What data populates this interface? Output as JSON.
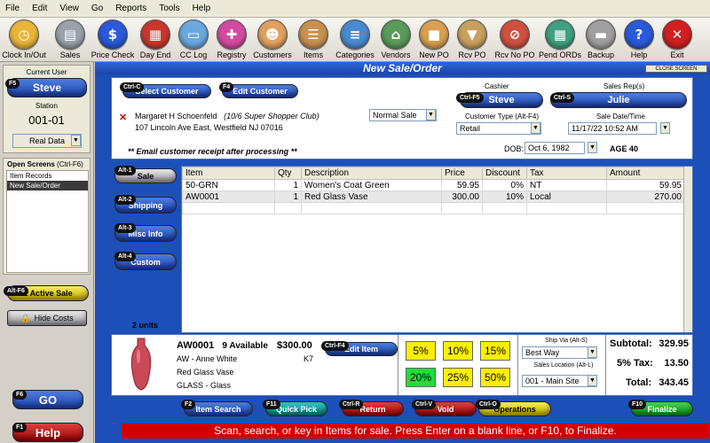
{
  "menu": [
    "File",
    "Edit",
    "View",
    "Go",
    "Reports",
    "Tools",
    "Help"
  ],
  "toolbar": [
    {
      "label": "Clock In/Out",
      "icon": "clock-icon",
      "color": "#e9b53a"
    },
    {
      "label": "Sales",
      "icon": "cash-drawer-icon",
      "color": "#9aa2aa"
    },
    {
      "label": "Price Check",
      "icon": "dollar-icon",
      "color": "#2b59d9"
    },
    {
      "label": "Day End",
      "icon": "calendar-icon",
      "color": "#c8382c"
    },
    {
      "label": "CC Log",
      "icon": "credit-card-icon",
      "color": "#6aa8e0"
    },
    {
      "label": "Registry",
      "icon": "gift-icon",
      "color": "#d24aa0"
    },
    {
      "label": "Customers",
      "icon": "customers-icon",
      "color": "#e0a060"
    },
    {
      "label": "Items",
      "icon": "shelves-icon",
      "color": "#c89050"
    },
    {
      "label": "Categories",
      "icon": "categories-icon",
      "color": "#4a8ad0"
    },
    {
      "label": "Vendors",
      "icon": "vendors-icon",
      "color": "#5a9a5a"
    },
    {
      "label": "New PO",
      "icon": "box-icon",
      "color": "#d8a050"
    },
    {
      "label": "Rcv PO",
      "icon": "receive-box-icon",
      "color": "#c8a060"
    },
    {
      "label": "Rcv No PO",
      "icon": "no-po-icon",
      "color": "#d05040"
    },
    {
      "label": "Pend ORDs",
      "icon": "pending-orders-icon",
      "color": "#40a080"
    },
    {
      "label": "Backup",
      "icon": "backup-icon",
      "color": "#a0a0a0"
    },
    {
      "label": "Help",
      "icon": "help-icon",
      "color": "#2b59d9"
    },
    {
      "label": "Exit",
      "icon": "exit-icon",
      "color": "#d02020"
    }
  ],
  "left": {
    "current_user_label": "Current User",
    "user_key": "F5",
    "user": "Steve",
    "station_label": "Station",
    "station": "001-01",
    "data_mode": "Real Data",
    "open_screens_title": "Open Screens",
    "open_screens_hint": "(Ctrl-F6)",
    "open_screens": [
      "Item Records",
      "New Sale/Order"
    ],
    "active_sale_key": "Alt-F6",
    "active_sale": "1 Active Sale",
    "hide_costs": "Hide Costs",
    "go_key": "F6",
    "go": "GO",
    "help_key": "F1",
    "help": "Help"
  },
  "window": {
    "title": "New Sale/Order",
    "close": "CLOSE SCREEN"
  },
  "customer": {
    "select_key": "Ctrl-C",
    "select": "Select Customer",
    "edit_key": "F4",
    "edit": "Edit Customer",
    "name": "Margaret H Schoenfeld",
    "club": "(10/6 Super Shopper Club)",
    "address": "107 Lincoln Ave East, Westfield NJ  07016",
    "email_note": "** Email customer receipt after processing **",
    "sale_type": "Normal Sale",
    "cashier_label": "Cashier",
    "cashier_key": "Ctrl-F5",
    "cashier": "Steve",
    "rep_label": "Sales Rep(s)",
    "rep_key": "Ctrl-S",
    "rep": "Julie",
    "ctype_label": "Customer Type (Alt-F4)",
    "ctype": "Retail",
    "date_label": "Sale Date/Time",
    "date": "11/17/22 10:52 AM",
    "dob_label": "DOB:",
    "dob": "Oct 6, 1982",
    "age": "AGE 40"
  },
  "side_tabs": [
    {
      "key": "Alt-1",
      "label": "Sale"
    },
    {
      "key": "Alt-2",
      "label": "Shipping"
    },
    {
      "key": "Alt-3",
      "label": "Misc Info"
    },
    {
      "key": "Alt-4",
      "label": "Custom"
    }
  ],
  "units": "2 units",
  "grid": {
    "headers": [
      "Item",
      "Qty",
      "Description",
      "Price",
      "Discount",
      "Tax",
      "Amount"
    ],
    "rows": [
      [
        "50-GRN",
        "1",
        "Women's Coat Green",
        "59.95",
        "0%",
        "NT",
        "59.95"
      ],
      [
        "AW0001",
        "1",
        "Red Glass Vase",
        "300.00",
        "10%",
        "Local",
        "270.00"
      ]
    ]
  },
  "detail": {
    "code": "AW0001",
    "available": "9 Available",
    "price": "$300.00",
    "vendor": "AW - Anne White",
    "bin": "K7",
    "desc": "Red Glass Vase",
    "cat": "GLASS - Glass",
    "edit_key": "Ctrl-F4",
    "edit": "Edit Item"
  },
  "discounts": [
    "5%",
    "10%",
    "15%",
    "20%",
    "25%",
    "50%"
  ],
  "ship": {
    "label": "Ship Via (Alt-S)",
    "value": "Best Way",
    "loc_label": "Sales Location (Alt-L)",
    "loc": "001 - Main Site"
  },
  "totals": {
    "subtotal_label": "Subtotal:",
    "subtotal": "329.95",
    "tax_label": "5% Tax:",
    "tax": "13.50",
    "total_label": "Total:",
    "total": "343.45"
  },
  "actions": [
    {
      "key": "F2",
      "label": "Item Search"
    },
    {
      "key": "F11",
      "label": "Quick Pick"
    },
    {
      "key": "Ctrl-R",
      "label": "Return"
    },
    {
      "key": "Ctrl-V",
      "label": "Void"
    },
    {
      "key": "Ctrl-O",
      "label": "Operations"
    },
    {
      "key": "F10",
      "label": "Finalize"
    }
  ],
  "status": "Scan, search, or key in Items for sale. Press Enter on a blank line, or F10, to Finalize."
}
